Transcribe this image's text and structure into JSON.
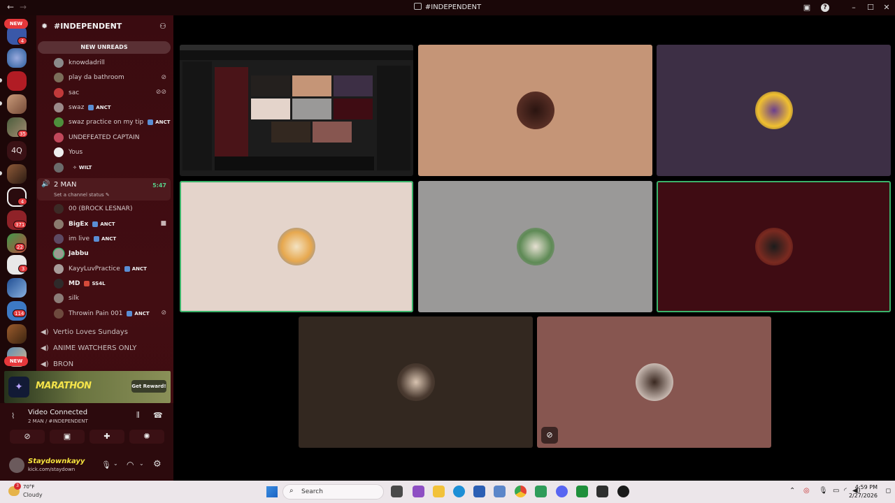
{
  "window": {
    "title": "#INDEPENDENT",
    "back_icon": "arrow-left-icon",
    "forward_icon": "arrow-right-icon"
  },
  "rail": {
    "new_top": "NEW",
    "new_bottom": "NEW",
    "badge_4a": "4",
    "label_4q": "4Q",
    "badge_35": "35",
    "badge_4b": "4",
    "badge_371": "371",
    "badge_22": "22",
    "badge_3": "3",
    "badge_114": "114"
  },
  "server": {
    "name": "#INDEPENDENT",
    "chevron": "⌄"
  },
  "sidebar": {
    "new_unreads": "NEW UNREADS"
  },
  "channel_a_users": [
    {
      "name": "knowdadrill",
      "tag": ""
    },
    {
      "name": "play da bathroom",
      "tag": ""
    },
    {
      "name": "sac",
      "tag": ""
    },
    {
      "name": "swaz",
      "tag": "ANCT"
    },
    {
      "name": "swaz practice on my tip",
      "tag": "ANCT"
    },
    {
      "name": "UNDEFEATED CAPTAIN",
      "tag": ""
    },
    {
      "name": "Yous",
      "tag": ""
    },
    {
      "name": "",
      "tag": "WILT"
    }
  ],
  "active_channel": {
    "name": "2 MAN",
    "time": "5:47",
    "status": "Set a channel status"
  },
  "channel_b_users": [
    {
      "name": "00 (BROCK LESNAR)",
      "tag": ""
    },
    {
      "name": "BigEx",
      "tag": "ANCT"
    },
    {
      "name": "im live",
      "tag": "ANCT"
    },
    {
      "name": "Jabbu",
      "tag": ""
    },
    {
      "name": "KayyLuvPractice",
      "tag": "ANCT"
    },
    {
      "name": "MD",
      "tag": "SS4L"
    },
    {
      "name": "silk",
      "tag": ""
    },
    {
      "name": "Throwin Pain 001",
      "tag": "ANCT"
    }
  ],
  "voice_channels": [
    "Vertio Loves Sundays",
    "ANIME WATCHERS ONLY",
    "BRON"
  ],
  "promo": {
    "title": "MARATHON",
    "button": "Get Reward!"
  },
  "voice_status": {
    "label": "Video Connected",
    "sub": "2 MAN / #INDEPENDENT"
  },
  "user": {
    "name": "Staydownkayy",
    "status": "kick.com/staydown"
  },
  "tiles_colors": [
    "#c59577",
    "#3d2f45",
    "#e4d4cb",
    "#9a9998",
    "#3f0c13",
    "#332820",
    "#875650"
  ],
  "taskbar": {
    "temp": "70°F",
    "condition": "Cloudy",
    "search": "Search",
    "time": "4:59 PM",
    "date": "2/27/2026",
    "weather_badge": "3"
  }
}
